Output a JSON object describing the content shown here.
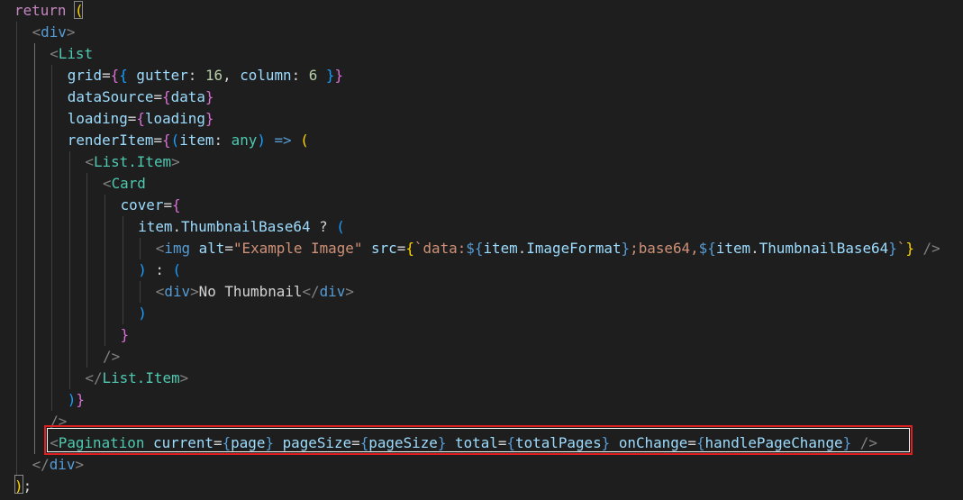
{
  "editor": {
    "theme_background": "#1e1e1e",
    "highlight_color": "#e02020",
    "lines": [
      {
        "indent": 0,
        "tokens": [
          [
            "kw",
            "return"
          ],
          [
            "txt",
            " "
          ],
          [
            "b1",
            "("
          ]
        ]
      },
      {
        "indent": 1,
        "tokens": [
          [
            "punc",
            "<"
          ],
          [
            "tag",
            "div"
          ],
          [
            "punc",
            ">"
          ]
        ]
      },
      {
        "indent": 2,
        "tokens": [
          [
            "punc",
            "<"
          ],
          [
            "comp",
            "List"
          ]
        ]
      },
      {
        "indent": 3,
        "tokens": [
          [
            "attr",
            "grid"
          ],
          [
            "txt",
            "="
          ],
          [
            "b2",
            "{"
          ],
          [
            "b3",
            "{"
          ],
          [
            "txt",
            " "
          ],
          [
            "attr",
            "gutter"
          ],
          [
            "txt",
            ": "
          ],
          [
            "num",
            "16"
          ],
          [
            "txt",
            ", "
          ],
          [
            "attr",
            "column"
          ],
          [
            "txt",
            ": "
          ],
          [
            "num",
            "6"
          ],
          [
            "txt",
            " "
          ],
          [
            "b3",
            "}"
          ],
          [
            "b2",
            "}"
          ]
        ]
      },
      {
        "indent": 3,
        "tokens": [
          [
            "attr",
            "dataSource"
          ],
          [
            "txt",
            "="
          ],
          [
            "b2",
            "{"
          ],
          [
            "attr",
            "data"
          ],
          [
            "b2",
            "}"
          ]
        ]
      },
      {
        "indent": 3,
        "tokens": [
          [
            "attr",
            "loading"
          ],
          [
            "txt",
            "="
          ],
          [
            "b2",
            "{"
          ],
          [
            "attr",
            "loading"
          ],
          [
            "b2",
            "}"
          ]
        ]
      },
      {
        "indent": 3,
        "tokens": [
          [
            "attr",
            "renderItem"
          ],
          [
            "txt",
            "="
          ],
          [
            "b2",
            "{"
          ],
          [
            "b3",
            "("
          ],
          [
            "attr",
            "item"
          ],
          [
            "txt",
            ": "
          ],
          [
            "type",
            "any"
          ],
          [
            "b3",
            ")"
          ],
          [
            "txt",
            " "
          ],
          [
            "tag",
            "=>"
          ],
          [
            "txt",
            " "
          ],
          [
            "b1",
            "("
          ]
        ]
      },
      {
        "indent": 4,
        "tokens": [
          [
            "punc",
            "<"
          ],
          [
            "comp",
            "List.Item"
          ],
          [
            "punc",
            ">"
          ]
        ]
      },
      {
        "indent": 5,
        "tokens": [
          [
            "punc",
            "<"
          ],
          [
            "comp",
            "Card"
          ]
        ]
      },
      {
        "indent": 6,
        "tokens": [
          [
            "attr",
            "cover"
          ],
          [
            "txt",
            "="
          ],
          [
            "b2",
            "{"
          ]
        ]
      },
      {
        "indent": 7,
        "tokens": [
          [
            "attr",
            "item"
          ],
          [
            "txt",
            "."
          ],
          [
            "attr",
            "ThumbnailBase64"
          ],
          [
            "txt",
            " ? "
          ],
          [
            "b3",
            "("
          ]
        ]
      },
      {
        "indent": 8,
        "tokens": [
          [
            "punc",
            "<"
          ],
          [
            "tag",
            "img"
          ],
          [
            "txt",
            " "
          ],
          [
            "attr",
            "alt"
          ],
          [
            "txt",
            "="
          ],
          [
            "str",
            "\"Example Image\""
          ],
          [
            "txt",
            " "
          ],
          [
            "attr",
            "src"
          ],
          [
            "txt",
            "="
          ],
          [
            "b1",
            "{"
          ],
          [
            "str",
            "`data:"
          ],
          [
            "tag",
            "${"
          ],
          [
            "attr",
            "item"
          ],
          [
            "txt",
            "."
          ],
          [
            "attr",
            "ImageFormat"
          ],
          [
            "tag",
            "}"
          ],
          [
            "str",
            ";base64,"
          ],
          [
            "tag",
            "${"
          ],
          [
            "attr",
            "item"
          ],
          [
            "txt",
            "."
          ],
          [
            "attr",
            "ThumbnailBase64"
          ],
          [
            "tag",
            "}"
          ],
          [
            "str",
            "`"
          ],
          [
            "b1",
            "}"
          ],
          [
            "txt",
            " "
          ],
          [
            "punc",
            "/>"
          ]
        ]
      },
      {
        "indent": 7,
        "tokens": [
          [
            "b3",
            ")"
          ],
          [
            "txt",
            " : "
          ],
          [
            "b3",
            "("
          ]
        ]
      },
      {
        "indent": 8,
        "tokens": [
          [
            "punc",
            "<"
          ],
          [
            "tag",
            "div"
          ],
          [
            "punc",
            ">"
          ],
          [
            "txt",
            "No Thumbnail"
          ],
          [
            "punc",
            "</"
          ],
          [
            "tag",
            "div"
          ],
          [
            "punc",
            ">"
          ]
        ]
      },
      {
        "indent": 7,
        "tokens": [
          [
            "b3",
            ")"
          ]
        ]
      },
      {
        "indent": 6,
        "tokens": [
          [
            "b2",
            "}"
          ]
        ]
      },
      {
        "indent": 5,
        "tokens": [
          [
            "punc",
            "/>"
          ]
        ]
      },
      {
        "indent": 4,
        "tokens": [
          [
            "punc",
            "</"
          ],
          [
            "comp",
            "List.Item"
          ],
          [
            "punc",
            ">"
          ]
        ]
      },
      {
        "indent": 3,
        "tokens": [
          [
            "b3",
            ")"
          ],
          [
            "b2",
            "}"
          ]
        ]
      },
      {
        "indent": 2,
        "tokens": [
          [
            "punc",
            "/>"
          ]
        ]
      },
      {
        "indent": 2,
        "tokens": [
          [
            "punc",
            "<"
          ],
          [
            "comp",
            "Pagination"
          ],
          [
            "txt",
            " "
          ],
          [
            "attr",
            "current"
          ],
          [
            "txt",
            "="
          ],
          [
            "tag",
            "{"
          ],
          [
            "attr",
            "page"
          ],
          [
            "tag",
            "}"
          ],
          [
            "txt",
            " "
          ],
          [
            "attr",
            "pageSize"
          ],
          [
            "txt",
            "="
          ],
          [
            "tag",
            "{"
          ],
          [
            "attr",
            "pageSize"
          ],
          [
            "tag",
            "}"
          ],
          [
            "txt",
            " "
          ],
          [
            "attr",
            "total"
          ],
          [
            "txt",
            "="
          ],
          [
            "tag",
            "{"
          ],
          [
            "attr",
            "totalPages"
          ],
          [
            "tag",
            "}"
          ],
          [
            "txt",
            " "
          ],
          [
            "attr",
            "onChange"
          ],
          [
            "txt",
            "="
          ],
          [
            "tag",
            "{"
          ],
          [
            "attr",
            "handlePageChange"
          ],
          [
            "tag",
            "}"
          ],
          [
            "txt",
            " "
          ],
          [
            "punc",
            "/>"
          ]
        ]
      },
      {
        "indent": 1,
        "tokens": [
          [
            "punc",
            "</"
          ],
          [
            "tag",
            "div"
          ],
          [
            "punc",
            ">"
          ]
        ]
      },
      {
        "indent": 0,
        "tokens": [
          [
            "b1",
            ")"
          ],
          [
            "txt",
            ";"
          ]
        ]
      }
    ]
  }
}
